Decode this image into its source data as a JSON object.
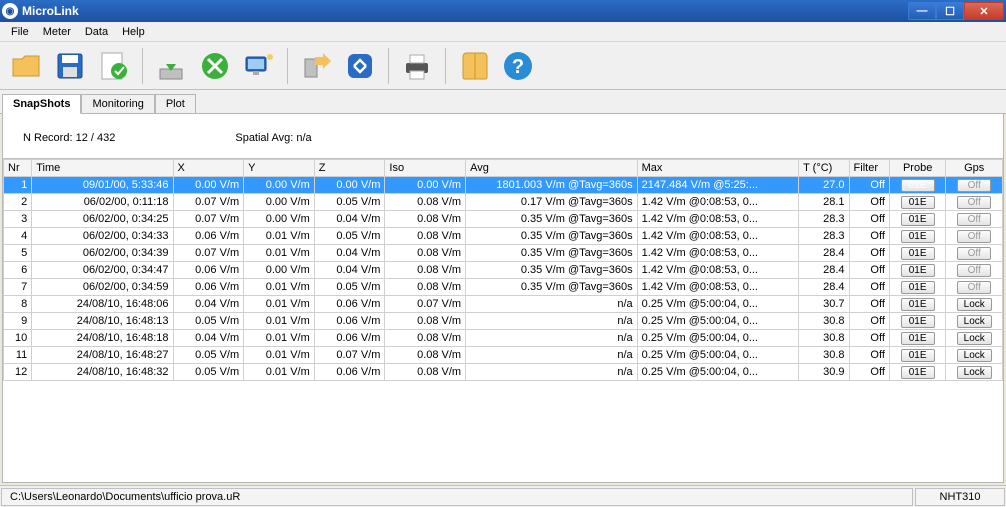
{
  "titlebar": {
    "title": "MicroLink"
  },
  "menu": {
    "file": "File",
    "meter": "Meter",
    "data": "Data",
    "help": "Help"
  },
  "tabs": {
    "snapshots": "SnapShots",
    "monitoring": "Monitoring",
    "plot": "Plot"
  },
  "info": {
    "nrecord_label": "N Record:",
    "nrecord_value": "12 / 432",
    "spatial_label": "Spatial Avg:",
    "spatial_value": "n/a"
  },
  "columns": {
    "nr": "Nr",
    "time": "Time",
    "x": "X",
    "y": "Y",
    "z": "Z",
    "iso": "Iso",
    "avg": "Avg",
    "max": "Max",
    "t": "T (°C)",
    "filter": "Filter",
    "probe": "Probe",
    "gps": "Gps"
  },
  "rows": [
    {
      "nr": "1",
      "time": "09/01/00, 5:33:46",
      "x": "0.00 V/m",
      "y": "0.00 V/m",
      "z": "0.00 V/m",
      "iso": "0.00 V/m",
      "avg": "1801.003 V/m @Tavg=360s",
      "max": "2147.484 V/m @5:25:...",
      "t": "27.0",
      "filter": "Off",
      "probe": "01E",
      "gps": "Off",
      "gps_lock": false,
      "selected": true
    },
    {
      "nr": "2",
      "time": "06/02/00, 0:11:18",
      "x": "0.07 V/m",
      "y": "0.00 V/m",
      "z": "0.05 V/m",
      "iso": "0.08 V/m",
      "avg": "0.17 V/m @Tavg=360s",
      "max": "1.42 V/m @0:08:53, 0...",
      "t": "28.1",
      "filter": "Off",
      "probe": "01E",
      "gps": "Off",
      "gps_lock": false
    },
    {
      "nr": "3",
      "time": "06/02/00, 0:34:25",
      "x": "0.07 V/m",
      "y": "0.00 V/m",
      "z": "0.04 V/m",
      "iso": "0.08 V/m",
      "avg": "0.35 V/m @Tavg=360s",
      "max": "1.42 V/m @0:08:53, 0...",
      "t": "28.3",
      "filter": "Off",
      "probe": "01E",
      "gps": "Off",
      "gps_lock": false
    },
    {
      "nr": "4",
      "time": "06/02/00, 0:34:33",
      "x": "0.06 V/m",
      "y": "0.01 V/m",
      "z": "0.05 V/m",
      "iso": "0.08 V/m",
      "avg": "0.35 V/m @Tavg=360s",
      "max": "1.42 V/m @0:08:53, 0...",
      "t": "28.3",
      "filter": "Off",
      "probe": "01E",
      "gps": "Off",
      "gps_lock": false
    },
    {
      "nr": "5",
      "time": "06/02/00, 0:34:39",
      "x": "0.07 V/m",
      "y": "0.01 V/m",
      "z": "0.04 V/m",
      "iso": "0.08 V/m",
      "avg": "0.35 V/m @Tavg=360s",
      "max": "1.42 V/m @0:08:53, 0...",
      "t": "28.4",
      "filter": "Off",
      "probe": "01E",
      "gps": "Off",
      "gps_lock": false
    },
    {
      "nr": "6",
      "time": "06/02/00, 0:34:47",
      "x": "0.06 V/m",
      "y": "0.00 V/m",
      "z": "0.04 V/m",
      "iso": "0.08 V/m",
      "avg": "0.35 V/m @Tavg=360s",
      "max": "1.42 V/m @0:08:53, 0...",
      "t": "28.4",
      "filter": "Off",
      "probe": "01E",
      "gps": "Off",
      "gps_lock": false
    },
    {
      "nr": "7",
      "time": "06/02/00, 0:34:59",
      "x": "0.06 V/m",
      "y": "0.01 V/m",
      "z": "0.05 V/m",
      "iso": "0.08 V/m",
      "avg": "0.35 V/m @Tavg=360s",
      "max": "1.42 V/m @0:08:53, 0...",
      "t": "28.4",
      "filter": "Off",
      "probe": "01E",
      "gps": "Off",
      "gps_lock": false
    },
    {
      "nr": "8",
      "time": "24/08/10, 16:48:06",
      "x": "0.04 V/m",
      "y": "0.01 V/m",
      "z": "0.06 V/m",
      "iso": "0.07 V/m",
      "avg": "n/a",
      "max": "0.25 V/m @5:00:04, 0...",
      "t": "30.7",
      "filter": "Off",
      "probe": "01E",
      "gps": "Lock",
      "gps_lock": true
    },
    {
      "nr": "9",
      "time": "24/08/10, 16:48:13",
      "x": "0.05 V/m",
      "y": "0.01 V/m",
      "z": "0.06 V/m",
      "iso": "0.08 V/m",
      "avg": "n/a",
      "max": "0.25 V/m @5:00:04, 0...",
      "t": "30.8",
      "filter": "Off",
      "probe": "01E",
      "gps": "Lock",
      "gps_lock": true
    },
    {
      "nr": "10",
      "time": "24/08/10, 16:48:18",
      "x": "0.04 V/m",
      "y": "0.01 V/m",
      "z": "0.06 V/m",
      "iso": "0.08 V/m",
      "avg": "n/a",
      "max": "0.25 V/m @5:00:04, 0...",
      "t": "30.8",
      "filter": "Off",
      "probe": "01E",
      "gps": "Lock",
      "gps_lock": true
    },
    {
      "nr": "11",
      "time": "24/08/10, 16:48:27",
      "x": "0.05 V/m",
      "y": "0.01 V/m",
      "z": "0.07 V/m",
      "iso": "0.08 V/m",
      "avg": "n/a",
      "max": "0.25 V/m @5:00:04, 0...",
      "t": "30.8",
      "filter": "Off",
      "probe": "01E",
      "gps": "Lock",
      "gps_lock": true
    },
    {
      "nr": "12",
      "time": "24/08/10, 16:48:32",
      "x": "0.05 V/m",
      "y": "0.01 V/m",
      "z": "0.06 V/m",
      "iso": "0.08 V/m",
      "avg": "n/a",
      "max": "0.25 V/m @5:00:04, 0...",
      "t": "30.9",
      "filter": "Off",
      "probe": "01E",
      "gps": "Lock",
      "gps_lock": true
    }
  ],
  "status": {
    "path": "C:\\Users\\Leonardo\\Documents\\ufficio prova.uR",
    "model": "NHT310"
  }
}
